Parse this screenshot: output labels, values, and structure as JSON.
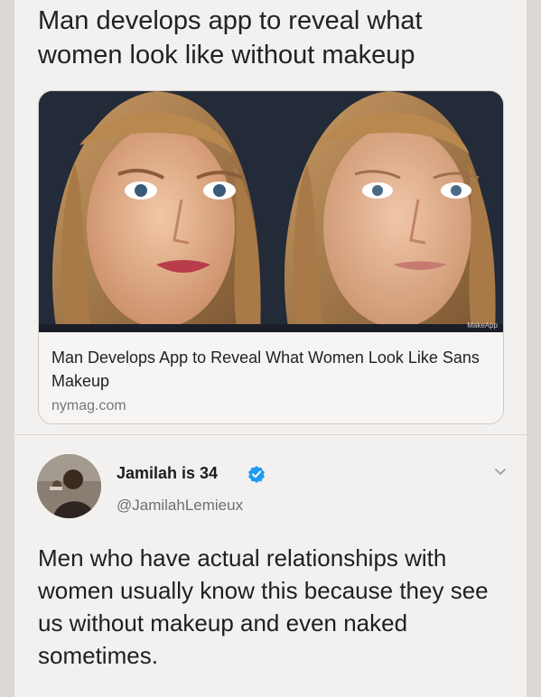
{
  "tweet": {
    "headline": "Man develops app to reveal what women look like without makeup",
    "card": {
      "title": "Man Develops App to Reveal What Women Look Like Sans Makeup",
      "domain": "nymag.com",
      "image_watermark": "MakeApp"
    }
  },
  "reply": {
    "display_name": "Jamilah is 34",
    "handle": "@JamilahLemieux",
    "text": "Men who have actual relationships with women usually know this because they see us without makeup and even naked sometimes.",
    "verified": true,
    "verified_badge_color": "#1d9bf0"
  },
  "icons": {
    "verified": "verified-badge-icon",
    "more": "chevron-down-icon"
  }
}
